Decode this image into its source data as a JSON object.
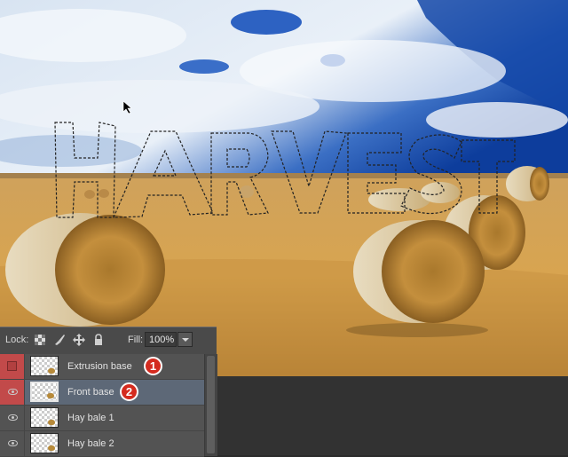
{
  "lock_bar": {
    "lock_label": "Lock:",
    "lock_icons": [
      "lock-transparent-pixels-icon",
      "lock-image-pixels-icon",
      "lock-position-icon",
      "lock-all-icon"
    ],
    "fill_label": "Fill:",
    "fill_value": "100%"
  },
  "layers": [
    {
      "name": "Extrusion base",
      "visible": false,
      "selected": false,
      "badge": "1"
    },
    {
      "name": "Front base",
      "visible": true,
      "selected": true,
      "badge": "2"
    },
    {
      "name": "Hay bale 1",
      "visible": true,
      "selected": false
    },
    {
      "name": "Hay bale 2",
      "visible": true,
      "selected": false
    }
  ],
  "canvas": {
    "selection_text": "HARVEST"
  },
  "colors": {
    "sky_top": "#0d3d9c",
    "field": "#d3a255",
    "selection_badge": "#d42b1f",
    "hidden_layer": "#c24a4a",
    "selected_layer": "#5d6877"
  }
}
